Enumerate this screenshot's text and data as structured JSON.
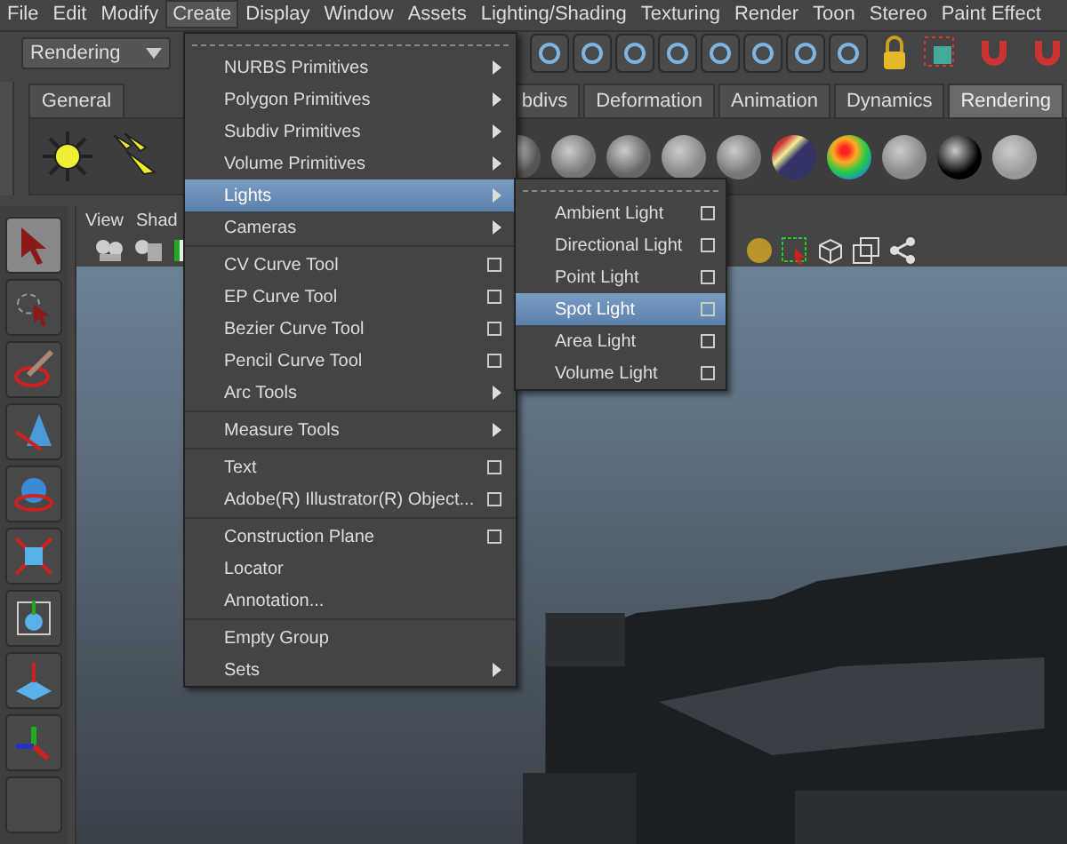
{
  "menubar": [
    {
      "label": "File",
      "selected": false
    },
    {
      "label": "Edit",
      "selected": false
    },
    {
      "label": "Modify",
      "selected": false
    },
    {
      "label": "Create",
      "selected": true
    },
    {
      "label": "Display",
      "selected": false
    },
    {
      "label": "Window",
      "selected": false
    },
    {
      "label": "Assets",
      "selected": false
    },
    {
      "label": "Lighting/Shading",
      "selected": false
    },
    {
      "label": "Texturing",
      "selected": false
    },
    {
      "label": "Render",
      "selected": false
    },
    {
      "label": "Toon",
      "selected": false
    },
    {
      "label": "Stereo",
      "selected": false
    },
    {
      "label": "Paint Effect",
      "selected": false
    }
  ],
  "status_line": {
    "mode_dropdown": "Rendering"
  },
  "shelf": {
    "tabs": [
      {
        "label": "General",
        "selected": false
      },
      {
        "label": "bdivs",
        "selected": false
      },
      {
        "label": "Deformation",
        "selected": false
      },
      {
        "label": "Animation",
        "selected": false
      },
      {
        "label": "Dynamics",
        "selected": false
      },
      {
        "label": "Rendering",
        "selected": true
      }
    ]
  },
  "panel": {
    "menus": [
      "View",
      "Shad"
    ]
  },
  "toolbox": [
    {
      "kind": "select",
      "selected": true
    },
    {
      "kind": "lasso",
      "selected": false
    },
    {
      "kind": "paint",
      "selected": false
    },
    {
      "kind": "move",
      "selected": false
    },
    {
      "kind": "rotate",
      "selected": false
    },
    {
      "kind": "scale",
      "selected": false
    },
    {
      "kind": "manipulator",
      "selected": false
    },
    {
      "kind": "soft",
      "selected": false
    },
    {
      "kind": "last",
      "selected": false
    },
    {
      "kind": "empty",
      "selected": false
    }
  ],
  "create_menu": {
    "groups": [
      [
        {
          "label": "NURBS Primitives",
          "kind": "submenu",
          "selected": false
        },
        {
          "label": "Polygon Primitives",
          "kind": "submenu",
          "selected": false
        },
        {
          "label": "Subdiv Primitives",
          "kind": "submenu",
          "selected": false
        },
        {
          "label": "Volume Primitives",
          "kind": "submenu",
          "selected": false
        },
        {
          "label": "Lights",
          "kind": "submenu",
          "selected": true
        },
        {
          "label": "Cameras",
          "kind": "submenu",
          "selected": false
        }
      ],
      [
        {
          "label": "CV Curve Tool",
          "kind": "option",
          "selected": false
        },
        {
          "label": "EP Curve Tool",
          "kind": "option",
          "selected": false
        },
        {
          "label": "Bezier Curve Tool",
          "kind": "option",
          "selected": false
        },
        {
          "label": "Pencil Curve Tool",
          "kind": "option",
          "selected": false
        },
        {
          "label": "Arc Tools",
          "kind": "submenu",
          "selected": false
        }
      ],
      [
        {
          "label": "Measure Tools",
          "kind": "submenu",
          "selected": false
        }
      ],
      [
        {
          "label": "Text",
          "kind": "option",
          "selected": false
        },
        {
          "label": "Adobe(R) Illustrator(R) Object...",
          "kind": "option",
          "selected": false
        }
      ],
      [
        {
          "label": "Construction Plane",
          "kind": "option",
          "selected": false
        },
        {
          "label": "Locator",
          "kind": "plain",
          "selected": false
        },
        {
          "label": "Annotation...",
          "kind": "plain",
          "selected": false
        }
      ],
      [
        {
          "label": "Empty Group",
          "kind": "plain",
          "selected": false
        },
        {
          "label": "Sets",
          "kind": "submenu",
          "selected": false
        }
      ]
    ]
  },
  "lights_submenu": {
    "items": [
      {
        "label": "Ambient Light",
        "kind": "option",
        "selected": false
      },
      {
        "label": "Directional Light",
        "kind": "option",
        "selected": false
      },
      {
        "label": "Point Light",
        "kind": "option",
        "selected": false
      },
      {
        "label": "Spot Light",
        "kind": "option",
        "selected": true
      },
      {
        "label": "Area Light",
        "kind": "option",
        "selected": false
      },
      {
        "label": "Volume Light",
        "kind": "option",
        "selected": false
      }
    ]
  }
}
